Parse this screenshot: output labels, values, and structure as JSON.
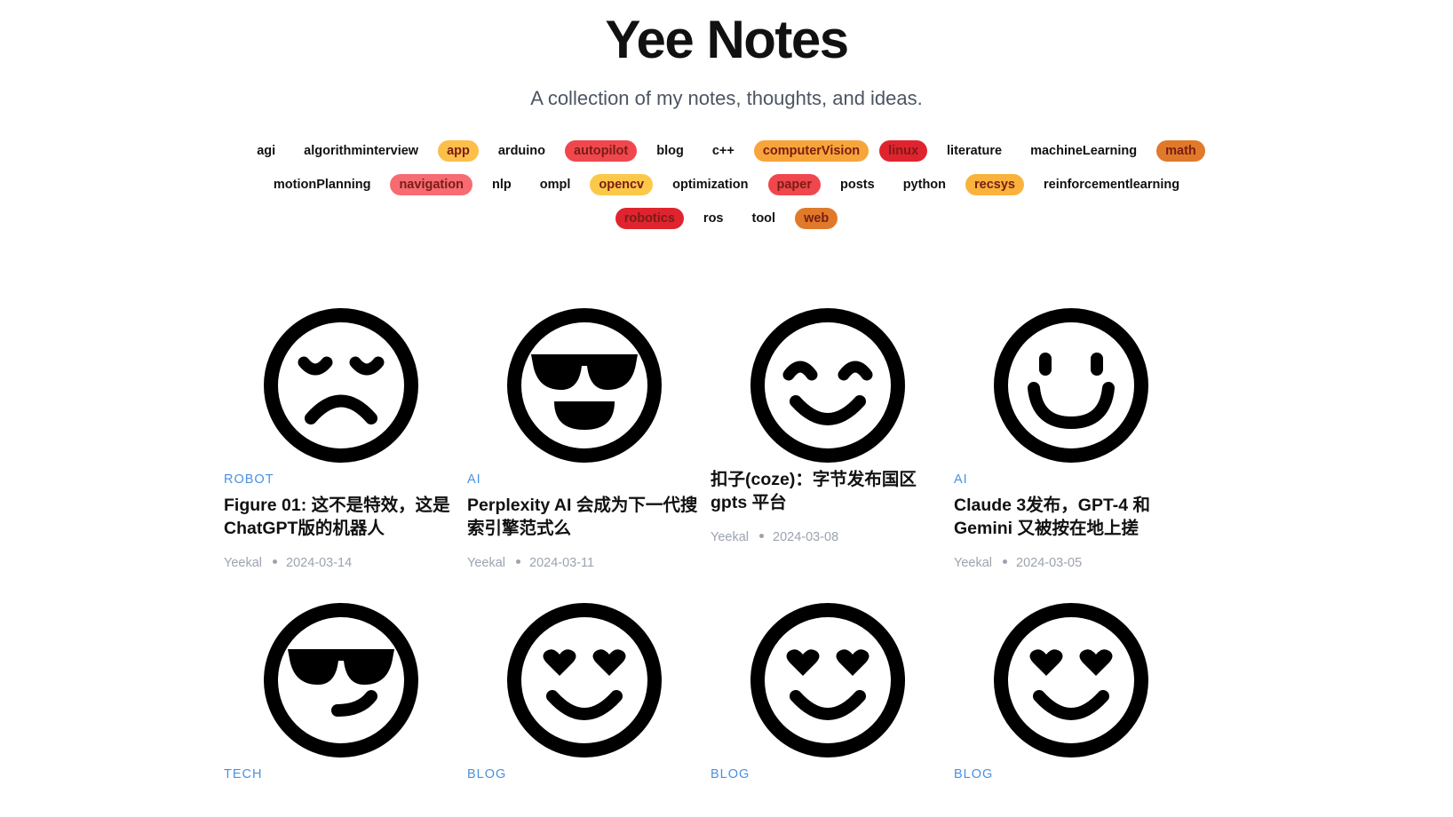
{
  "header": {
    "title": "Yee Notes",
    "subtitle": "A collection of my notes, thoughts, and ideas."
  },
  "tags": [
    {
      "label": "agi",
      "color": ""
    },
    {
      "label": "algorithminterview",
      "color": ""
    },
    {
      "label": "app",
      "color": "#fbbf4a"
    },
    {
      "label": "arduino",
      "color": ""
    },
    {
      "label": "autopilot",
      "color": "#f0474e"
    },
    {
      "label": "blog",
      "color": ""
    },
    {
      "label": "c++",
      "color": ""
    },
    {
      "label": "computerVision",
      "color": "#f7a53b"
    },
    {
      "label": "linux",
      "color": "#e0242f"
    },
    {
      "label": "literature",
      "color": ""
    },
    {
      "label": "machineLearning",
      "color": ""
    },
    {
      "label": "math",
      "color": "#e07a2a"
    },
    {
      "label": "motionPlanning",
      "color": ""
    },
    {
      "label": "navigation",
      "color": "#f76b73"
    },
    {
      "label": "nlp",
      "color": ""
    },
    {
      "label": "ompl",
      "color": ""
    },
    {
      "label": "opencv",
      "color": "#fcc84a"
    },
    {
      "label": "optimization",
      "color": ""
    },
    {
      "label": "paper",
      "color": "#f0474e"
    },
    {
      "label": "posts",
      "color": ""
    },
    {
      "label": "python",
      "color": ""
    },
    {
      "label": "recsys",
      "color": "#f9b33c"
    },
    {
      "label": "reinforcementlearning",
      "color": ""
    },
    {
      "label": "robotics",
      "color": "#e0242f"
    },
    {
      "label": "ros",
      "color": ""
    },
    {
      "label": "tool",
      "color": ""
    },
    {
      "label": "web",
      "color": "#e07a2a"
    }
  ],
  "posts": [
    {
      "emoji": "sad-face-icon",
      "category": "ROBOT",
      "title": "Figure 01: 这不是特效，这是ChatGPT版的机器人",
      "author": "Yeekal",
      "date": "2024-03-14"
    },
    {
      "emoji": "sunglasses-grin-face-icon",
      "category": "AI",
      "title": "Perplexity AI 会成为下一代搜索引擎范式么",
      "author": "Yeekal",
      "date": "2024-03-11"
    },
    {
      "emoji": "happy-closed-eyes-face-icon",
      "category": "",
      "title": "扣子(coze)：字节发布国区gpts 平台",
      "author": "Yeekal",
      "date": "2024-03-08"
    },
    {
      "emoji": "smile-face-icon",
      "category": "AI",
      "title": "Claude 3发布，GPT-4 和 Gemini 又被按在地上搓",
      "author": "Yeekal",
      "date": "2024-03-05"
    },
    {
      "emoji": "sunglasses-smirk-face-icon",
      "category": "TECH",
      "title": "",
      "author": "",
      "date": ""
    },
    {
      "emoji": "heart-eyes-face-icon",
      "category": "BLOG",
      "title": "",
      "author": "",
      "date": ""
    },
    {
      "emoji": "heart-eyes-face-icon",
      "category": "BLOG",
      "title": "",
      "author": "",
      "date": ""
    },
    {
      "emoji": "heart-eyes-face-icon",
      "category": "BLOG",
      "title": "",
      "author": "",
      "date": ""
    }
  ]
}
